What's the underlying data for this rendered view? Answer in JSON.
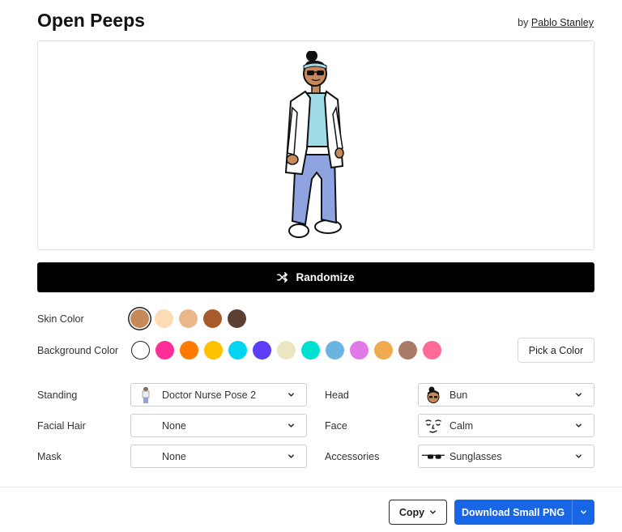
{
  "header": {
    "title": "Open Peeps",
    "by_prefix": "by",
    "author": "Pablo Stanley"
  },
  "randomize": {
    "label": "Randomize",
    "icon": "shuffle-icon"
  },
  "skin_color": {
    "label": "Skin Color",
    "selected_index": 0,
    "swatches": [
      "#c68a5a",
      "#fddcb5",
      "#e8b88a",
      "#a85a2a",
      "#5c4033"
    ]
  },
  "background_color": {
    "label": "Background Color",
    "selected_index": 0,
    "swatches": [
      "#ffffff",
      "#ff2d96",
      "#ff7a00",
      "#ffc000",
      "#00d4f0",
      "#5c3cf5",
      "#ece6c0",
      "#00e0d0",
      "#6ab4e0",
      "#e07ae8",
      "#f0aa50",
      "#a87a68",
      "#ff6b98"
    ],
    "pick_color_label": "Pick a Color"
  },
  "options": {
    "standing": {
      "label": "Standing",
      "value": "Doctor Nurse Pose 2",
      "thumb": "standing-pose-thumb"
    },
    "head": {
      "label": "Head",
      "value": "Bun",
      "thumb": "bun-head-thumb"
    },
    "facial_hair": {
      "label": "Facial Hair",
      "value": "None"
    },
    "face": {
      "label": "Face",
      "value": "Calm",
      "thumb": "calm-face-thumb"
    },
    "mask": {
      "label": "Mask",
      "value": "None"
    },
    "accessories": {
      "label": "Accessories",
      "value": "Sunglasses",
      "thumb": "sunglasses-thumb"
    }
  },
  "footer": {
    "copy_label": "Copy",
    "download_label": "Download Small PNG",
    "accent": "#1766e8"
  }
}
